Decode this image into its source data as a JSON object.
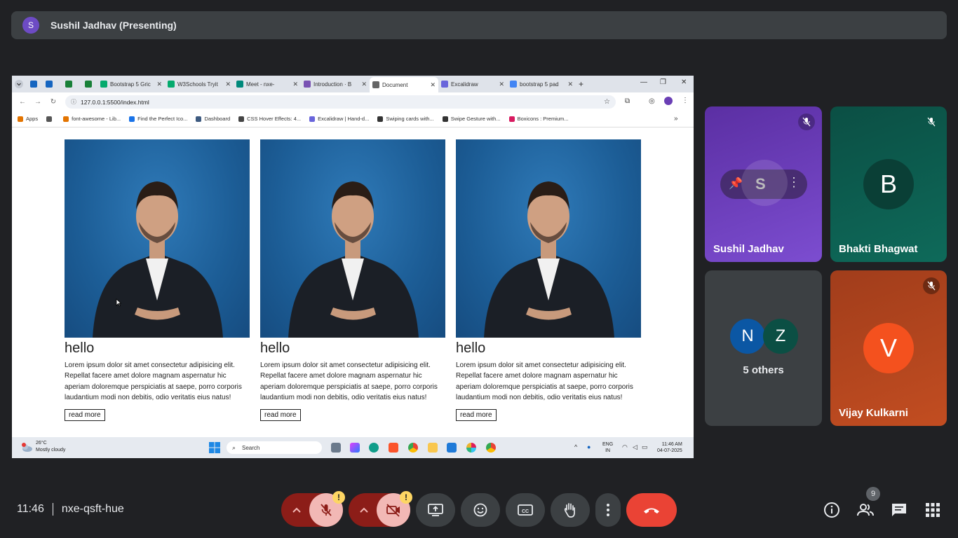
{
  "presenter": {
    "initial": "S",
    "label": "Sushil Jadhav (Presenting)"
  },
  "browser": {
    "tabs": [
      {
        "label": "",
        "icon_color": "#1565c0"
      },
      {
        "label": "",
        "icon_color": "#1565c0"
      },
      {
        "label": "",
        "icon_color": "#188038"
      },
      {
        "label": "",
        "icon_color": "#188038"
      },
      {
        "label": "Bootstrap 5 Gric",
        "icon_color": "#04aa6d"
      },
      {
        "label": "W3Schools Tryit",
        "icon_color": "#04aa6d"
      },
      {
        "label": "Meet - nxe-",
        "icon_color": "#00897b"
      },
      {
        "label": "Introduction · B",
        "icon_color": "#7952b3"
      },
      {
        "label": "Document",
        "icon_color": "#666666",
        "active": true
      },
      {
        "label": "Excalidraw",
        "icon_color": "#6965db"
      },
      {
        "label": "bootstrap 5 pad",
        "icon_color": "#4285f4"
      }
    ],
    "new_tab": "+",
    "url": "127.0.0.1:5500/index.html",
    "bookmarks": [
      {
        "label": "Apps",
        "icon_color": "#e37400"
      },
      {
        "label": "",
        "icon_color": "#555555"
      },
      {
        "label": "font-awesome - Lib...",
        "icon_color": "#e37400"
      },
      {
        "label": "Find the Perfect Ico...",
        "icon_color": "#1a73e8"
      },
      {
        "label": "Dashboard",
        "icon_color": "#3d5a80"
      },
      {
        "label": "CSS Hover Effects: 4...",
        "icon_color": "#444444"
      },
      {
        "label": "Excalidraw | Hand-d...",
        "icon_color": "#6965db"
      },
      {
        "label": "Swiping cards with...",
        "icon_color": "#333333"
      },
      {
        "label": "Swipe Gesture with...",
        "icon_color": "#333333"
      },
      {
        "label": "Boxicons : Premium...",
        "icon_color": "#d81b60"
      }
    ],
    "bookmarks_more": "»"
  },
  "webpage": {
    "cards": [
      {
        "title": "hello",
        "text": "Lorem ipsum dolor sit amet consectetur adipisicing elit. Repellat facere amet dolore magnam aspernatur hic aperiam doloremque perspiciatis at saepe, porro corporis laudantium modi non debitis, odio veritatis eius natus!",
        "button": "read more"
      },
      {
        "title": "hello",
        "text": "Lorem ipsum dolor sit amet consectetur adipisicing elit. Repellat facere amet dolore magnam aspernatur hic aperiam doloremque perspiciatis at saepe, porro corporis laudantium modi non debitis, odio veritatis eius natus!",
        "button": "read more"
      },
      {
        "title": "hello",
        "text": "Lorem ipsum dolor sit amet consectetur adipisicing elit. Repellat facere amet dolore magnam aspernatur hic aperiam doloremque perspiciatis at saepe, porro corporis laudantium modi non debitis, odio veritatis eius natus!",
        "button": "read more"
      }
    ]
  },
  "taskbar": {
    "temperature": "26°C",
    "weather": "Mostly cloudy",
    "search_placeholder": "Search",
    "lang_top": "ENG",
    "lang_bottom": "IN",
    "time": "11:46 AM",
    "date": "04-07-2025"
  },
  "participants": [
    {
      "name": "Sushil Jadhav",
      "initial": "S",
      "bg": "#6a3fb5",
      "muted": true
    },
    {
      "name": "Bhakti Bhagwat",
      "initial": "B",
      "bg": "#0b5d4f",
      "muted": true
    },
    {
      "name": "5 others",
      "initials": [
        "N",
        "Z"
      ],
      "bg": "#3c4043"
    },
    {
      "name": "Vijay Kulkarni",
      "initial": "V",
      "bg": "#b3401f",
      "muted": true
    }
  ],
  "meeting": {
    "time": "11:46",
    "code": "nxe-qsft-hue",
    "people_count": "9",
    "warning_badge": "!"
  },
  "colors": {
    "end_call": "#ea4335",
    "muted_control": "#f2b8b5",
    "muted_control_dark": "#8c1d18",
    "control": "#3c4043"
  }
}
